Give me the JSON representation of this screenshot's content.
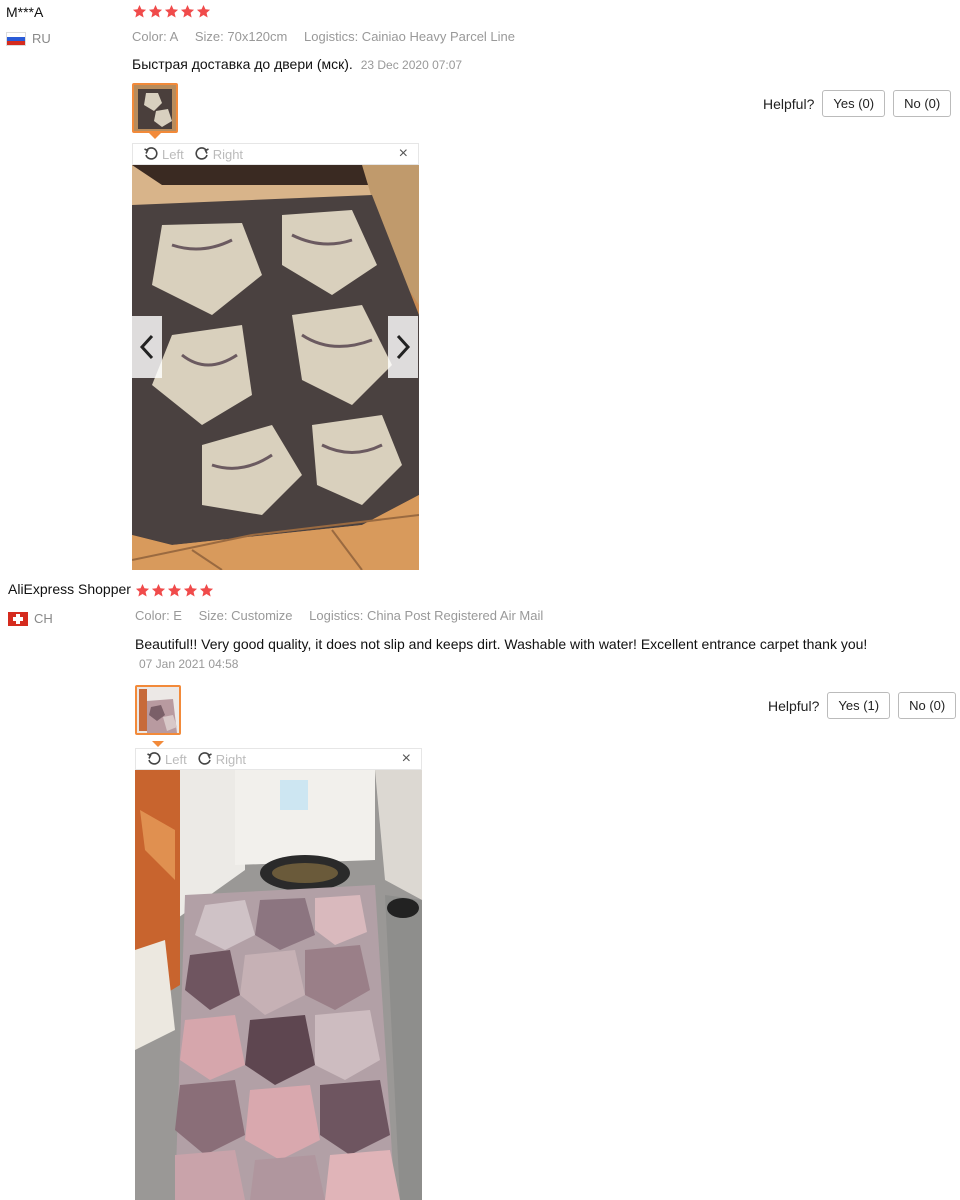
{
  "reviews": [
    {
      "user": "M***A",
      "country": "RU",
      "rating": 5,
      "color_label": "Color: A",
      "size_label": "Size: 70x120cm",
      "logistics_label": "Logistics: Cainiao Heavy Parcel Line",
      "text": "Быстрая доставка до двери (мск).",
      "date": "23 Dec 2020 07:07",
      "helpful_label": "Helpful?",
      "yes_label": "Yes (0)",
      "no_label": "No (0)",
      "rotate_left": "Left",
      "rotate_right": "Right",
      "close": "×",
      "prev": "‹",
      "next": "›"
    },
    {
      "user": "AliExpress Shopper",
      "country": "CH",
      "rating": 5,
      "color_label": "Color: E",
      "size_label": "Size: Customize",
      "logistics_label": "Logistics: China Post Registered Air Mail",
      "text": "Beautiful!! Very good quality, it does not slip and keeps dirt. Washable with water! Excellent entrance carpet thank you!",
      "date": "07 Jan 2021 04:58",
      "helpful_label": "Helpful?",
      "yes_label": "Yes (1)",
      "no_label": "No (0)",
      "rotate_left": "Left",
      "rotate_right": "Right",
      "close": "×"
    }
  ],
  "colors": {
    "star": "#f04b4b",
    "thumb_border": "#f28a3a",
    "muted_text": "#999999"
  }
}
